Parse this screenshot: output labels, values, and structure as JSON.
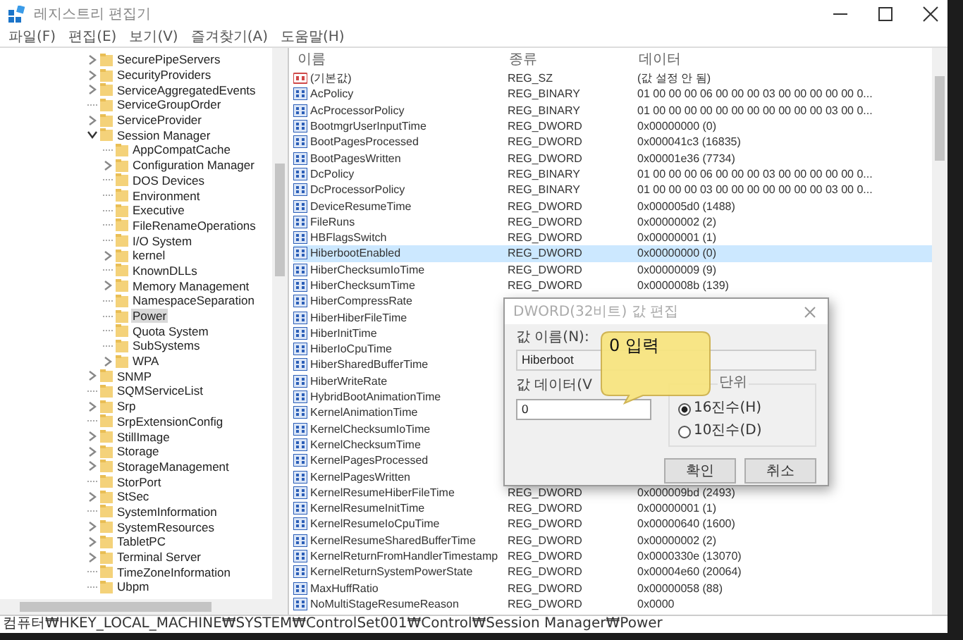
{
  "window": {
    "title": "레지스트리 편집기"
  },
  "menu": [
    "파일(F)",
    "편집(E)",
    "보기(V)",
    "즐겨찾기(A)",
    "도움말(H)"
  ],
  "tree": [
    {
      "label": "SecurePipeServers",
      "expandable": true,
      "expanded": false,
      "selected": false
    },
    {
      "label": "SecurityProviders",
      "expandable": true,
      "expanded": false,
      "selected": false
    },
    {
      "label": "ServiceAggregatedEvents",
      "expandable": true,
      "expanded": false,
      "selected": false
    },
    {
      "label": "ServiceGroupOrder",
      "expandable": false,
      "selected": false
    },
    {
      "label": "ServiceProvider",
      "expandable": true,
      "expanded": false,
      "selected": false
    },
    {
      "label": "Session Manager",
      "expandable": true,
      "expanded": true,
      "selected": false,
      "children": [
        {
          "label": "AppCompatCache",
          "expandable": false,
          "selected": false
        },
        {
          "label": "Configuration Manager",
          "expandable": true,
          "expanded": false,
          "selected": false
        },
        {
          "label": "DOS Devices",
          "expandable": false,
          "selected": false
        },
        {
          "label": "Environment",
          "expandable": false,
          "selected": false
        },
        {
          "label": "Executive",
          "expandable": false,
          "selected": false
        },
        {
          "label": "FileRenameOperations",
          "expandable": false,
          "selected": false
        },
        {
          "label": "I/O System",
          "expandable": false,
          "selected": false
        },
        {
          "label": "kernel",
          "expandable": true,
          "expanded": false,
          "selected": false
        },
        {
          "label": "KnownDLLs",
          "expandable": false,
          "selected": false
        },
        {
          "label": "Memory Management",
          "expandable": true,
          "expanded": false,
          "selected": false
        },
        {
          "label": "NamespaceSeparation",
          "expandable": false,
          "selected": false
        },
        {
          "label": "Power",
          "expandable": false,
          "selected": true
        },
        {
          "label": "Quota System",
          "expandable": false,
          "selected": false
        },
        {
          "label": "SubSystems",
          "expandable": false,
          "selected": false
        },
        {
          "label": "WPA",
          "expandable": true,
          "expanded": false,
          "selected": false
        }
      ]
    },
    {
      "label": "SNMP",
      "expandable": true,
      "expanded": false,
      "selected": false
    },
    {
      "label": "SQMServiceList",
      "expandable": false,
      "selected": false
    },
    {
      "label": "Srp",
      "expandable": true,
      "expanded": false,
      "selected": false
    },
    {
      "label": "SrpExtensionConfig",
      "expandable": false,
      "selected": false
    },
    {
      "label": "StillImage",
      "expandable": true,
      "expanded": false,
      "selected": false
    },
    {
      "label": "Storage",
      "expandable": true,
      "expanded": false,
      "selected": false
    },
    {
      "label": "StorageManagement",
      "expandable": true,
      "expanded": false,
      "selected": false
    },
    {
      "label": "StorPort",
      "expandable": false,
      "selected": false
    },
    {
      "label": "StSec",
      "expandable": true,
      "expanded": false,
      "selected": false
    },
    {
      "label": "SystemInformation",
      "expandable": false,
      "selected": false
    },
    {
      "label": "SystemResources",
      "expandable": true,
      "expanded": false,
      "selected": false
    },
    {
      "label": "TabletPC",
      "expandable": true,
      "expanded": false,
      "selected": false
    },
    {
      "label": "Terminal Server",
      "expandable": true,
      "expanded": false,
      "selected": false
    },
    {
      "label": "TimeZoneInformation",
      "expandable": false,
      "selected": false
    },
    {
      "label": "Ubpm",
      "expandable": false,
      "selected": false
    }
  ],
  "table": {
    "columns": [
      "이름",
      "종류",
      "데이터"
    ],
    "rows": [
      {
        "kind": "string",
        "name": "(기본값)",
        "type": "REG_SZ",
        "data": "(값 설정 안 됨)",
        "selected": false
      },
      {
        "kind": "binary",
        "name": "AcPolicy",
        "type": "REG_BINARY",
        "data": "01 00 00 00 06 00 00 00 03 00 00 00 00 00 0...",
        "selected": false
      },
      {
        "kind": "binary",
        "name": "AcProcessorPolicy",
        "type": "REG_BINARY",
        "data": "01 00 00 00 00 00 00 00 00 00 00 00 03 00 0...",
        "selected": false
      },
      {
        "kind": "binary",
        "name": "BootmgrUserInputTime",
        "type": "REG_DWORD",
        "data": "0x00000000 (0)",
        "selected": false
      },
      {
        "kind": "binary",
        "name": "BootPagesProcessed",
        "type": "REG_DWORD",
        "data": "0x000041c3 (16835)",
        "selected": false
      },
      {
        "kind": "binary",
        "name": "BootPagesWritten",
        "type": "REG_DWORD",
        "data": "0x00001e36 (7734)",
        "selected": false
      },
      {
        "kind": "binary",
        "name": "DcPolicy",
        "type": "REG_BINARY",
        "data": "01 00 00 00 06 00 00 00 03 00 00 00 00 00 0...",
        "selected": false
      },
      {
        "kind": "binary",
        "name": "DcProcessorPolicy",
        "type": "REG_BINARY",
        "data": "01 00 00 00 03 00 00 00 00 00 00 00 03 00 0...",
        "selected": false
      },
      {
        "kind": "binary",
        "name": "DeviceResumeTime",
        "type": "REG_DWORD",
        "data": "0x000005d0 (1488)",
        "selected": false
      },
      {
        "kind": "binary",
        "name": "FileRuns",
        "type": "REG_DWORD",
        "data": "0x00000002 (2)",
        "selected": false
      },
      {
        "kind": "binary",
        "name": "HBFlagsSwitch",
        "type": "REG_DWORD",
        "data": "0x00000001 (1)",
        "selected": false
      },
      {
        "kind": "binary",
        "name": "HiberbootEnabled",
        "type": "REG_DWORD",
        "data": "0x00000000 (0)",
        "selected": true
      },
      {
        "kind": "binary",
        "name": "HiberChecksumIoTime",
        "type": "REG_DWORD",
        "data": "0x00000009 (9)",
        "selected": false
      },
      {
        "kind": "binary",
        "name": "HiberChecksumTime",
        "type": "REG_DWORD",
        "data": "0x0000008b (139)",
        "selected": false
      },
      {
        "kind": "binary",
        "name": "HiberCompressRate",
        "selected": false
      },
      {
        "kind": "binary",
        "name": "HiberHiberFileTime",
        "selected": false
      },
      {
        "kind": "binary",
        "name": "HiberInitTime",
        "selected": false
      },
      {
        "kind": "binary",
        "name": "HiberIoCpuTime",
        "selected": false
      },
      {
        "kind": "binary",
        "name": "HiberSharedBufferTime",
        "selected": false
      },
      {
        "kind": "binary",
        "name": "HiberWriteRate",
        "selected": false
      },
      {
        "kind": "binary",
        "name": "HybridBootAnimationTime",
        "selected": false
      },
      {
        "kind": "binary",
        "name": "KernelAnimationTime",
        "selected": false
      },
      {
        "kind": "binary",
        "name": "KernelChecksumIoTime",
        "selected": false
      },
      {
        "kind": "binary",
        "name": "KernelChecksumTime",
        "selected": false
      },
      {
        "kind": "binary",
        "name": "KernelPagesProcessed",
        "selected": false
      },
      {
        "kind": "binary",
        "name": "KernelPagesWritten",
        "selected": false
      },
      {
        "kind": "binary",
        "name": "KernelResumeHiberFileTime",
        "type": "REG_DWORD",
        "data": "0x000009bd (2493)",
        "selected": false
      },
      {
        "kind": "binary",
        "name": "KernelResumeInitTime",
        "type": "REG_DWORD",
        "data": "0x00000001 (1)",
        "selected": false
      },
      {
        "kind": "binary",
        "name": "KernelResumeIoCpuTime",
        "type": "REG_DWORD",
        "data": "0x00000640 (1600)",
        "selected": false
      },
      {
        "kind": "binary",
        "name": "KernelResumeSharedBufferTime",
        "type": "REG_DWORD",
        "data": "0x00000002 (2)",
        "selected": false
      },
      {
        "kind": "binary",
        "name": "KernelReturnFromHandlerTimestamp",
        "type": "REG_DWORD",
        "data": "0x0000330e (13070)",
        "selected": false
      },
      {
        "kind": "binary",
        "name": "KernelReturnSystemPowerState",
        "type": "REG_DWORD",
        "data": "0x00004e60 (20064)",
        "selected": false
      },
      {
        "kind": "binary",
        "name": "MaxHuffRatio",
        "type": "REG_DWORD",
        "data": "0x00000058 (88)",
        "selected": false
      },
      {
        "kind": "binary",
        "name": "NoMultiStageResumeReason",
        "type": "REG_DWORD",
        "data": "0x0000",
        "selected": false
      }
    ]
  },
  "status_bar": "컴퓨터₩HKEY_LOCAL_MACHINE₩SYSTEM₩ControlSet001₩Control₩Session Manager₩Power",
  "dialog": {
    "title": "DWORD(32비트) 값 편집",
    "name_label": "값 이름(N):",
    "name_value": "Hiberboot",
    "data_label": "값 데이터(V",
    "data_value": "0",
    "base_label": "단위",
    "bases": [
      {
        "label": "16진수(H)",
        "selected": true
      },
      {
        "label": "10진수(D)",
        "selected": false
      }
    ],
    "buttons": [
      "확인",
      "취소"
    ]
  },
  "callout": "0 입력"
}
